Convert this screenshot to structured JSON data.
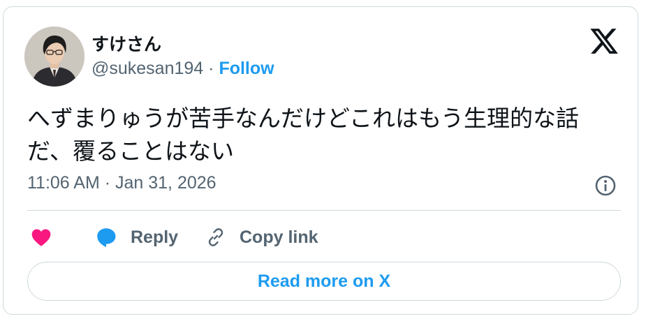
{
  "author": {
    "display_name": "すけさん",
    "handle": "@sukesan194",
    "separator": " · ",
    "follow_label": "Follow",
    "avatar_icon": "avatar-portrait-man-glasses-suit"
  },
  "tweet": {
    "text": "へずまりゅうが苦手なんだけどこれはもう生理的な話だ、覆ることはない",
    "timestamp": "11:06 AM · Jan 31, 2026"
  },
  "actions": {
    "like_icon": "heart-icon",
    "reply_label": "Reply",
    "copy_link_label": "Copy link"
  },
  "footer": {
    "read_more_label": "Read more on X"
  },
  "colors": {
    "text": "#0f1419",
    "muted": "#536471",
    "accent": "#1d9bf0",
    "like": "#f91880",
    "border": "#cfd9de"
  }
}
